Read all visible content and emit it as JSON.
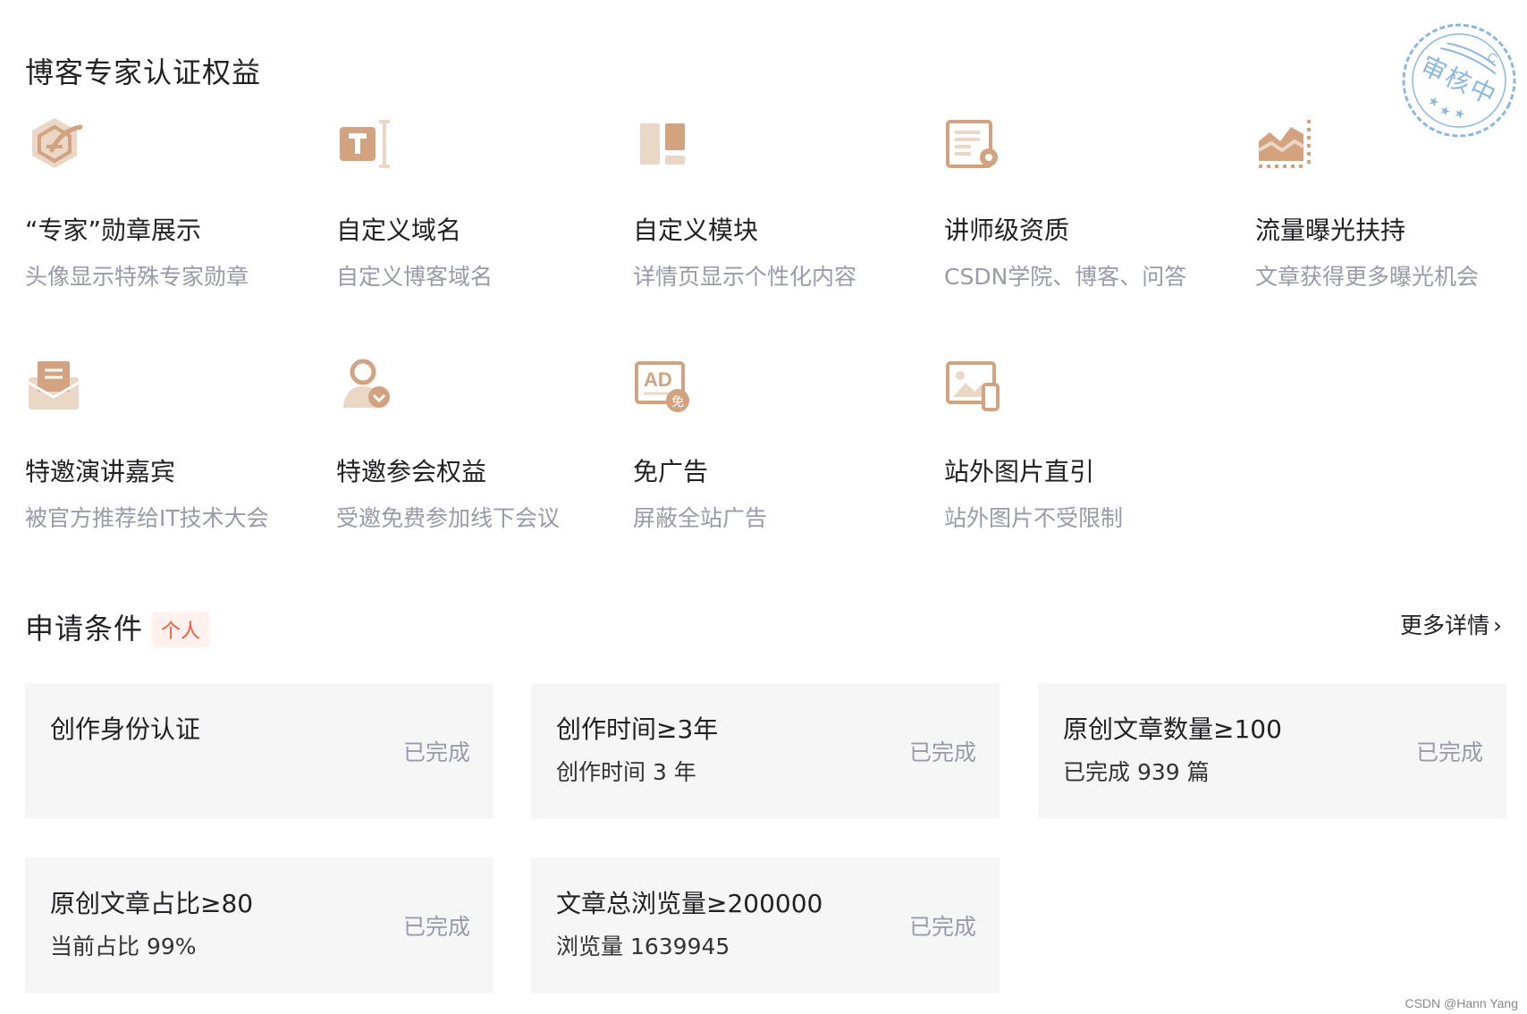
{
  "benefits_section": {
    "title": "博客专家认证权益"
  },
  "benefits": [
    {
      "title": "“专家”勋章展示",
      "desc": "头像显示特殊专家勋章",
      "icon": "badge-icon"
    },
    {
      "title": "自定义域名",
      "desc": "自定义博客域名",
      "icon": "text-domain-icon"
    },
    {
      "title": "自定义模块",
      "desc": "详情页显示个性化内容",
      "icon": "layout-module-icon"
    },
    {
      "title": "讲师级资质",
      "desc": "CSDN学院、博客、问答",
      "icon": "certificate-gear-icon"
    },
    {
      "title": "流量曝光扶持",
      "desc": "文章获得更多曝光机会",
      "icon": "traffic-chart-icon"
    },
    {
      "title": "特邀演讲嘉宾",
      "desc": "被官方推荐给IT技术大会",
      "icon": "invitation-envelope-icon"
    },
    {
      "title": "特邀参会权益",
      "desc": "受邀免费参加线下会议",
      "icon": "location-person-icon"
    },
    {
      "title": "免广告",
      "desc": "屏蔽全站广告",
      "icon": "ad-free-icon"
    },
    {
      "title": "站外图片直引",
      "desc": "站外图片不受限制",
      "icon": "external-image-icon"
    }
  ],
  "conditions_section": {
    "title": "申请条件",
    "tag": "个人",
    "more_label": "更多详情"
  },
  "conditions": [
    {
      "title": "创作身份认证",
      "sub": "",
      "status": "已完成"
    },
    {
      "title": "创作时间≥3年",
      "sub": "创作时间 3 年",
      "status": "已完成"
    },
    {
      "title": "原创文章数量≥100",
      "sub": "已完成 939 篇",
      "status": "已完成"
    },
    {
      "title": "原创文章占比≥80",
      "sub": "当前占比 99%",
      "status": "已完成"
    },
    {
      "title": "文章总浏览量≥200000",
      "sub": "浏览量 1639945",
      "status": "已完成"
    }
  ],
  "stamp": {
    "text": "审核中",
    "mark": "C"
  },
  "watermark": "CSDN @Hann Yang",
  "colors": {
    "icon_dark": "#d2a37e",
    "icon_light": "#ead7c6",
    "tag_text": "#fc5531",
    "tag_bg": "#fff1ee",
    "stamp": "#8ab8e6",
    "card_bg": "#f6f6f6"
  }
}
